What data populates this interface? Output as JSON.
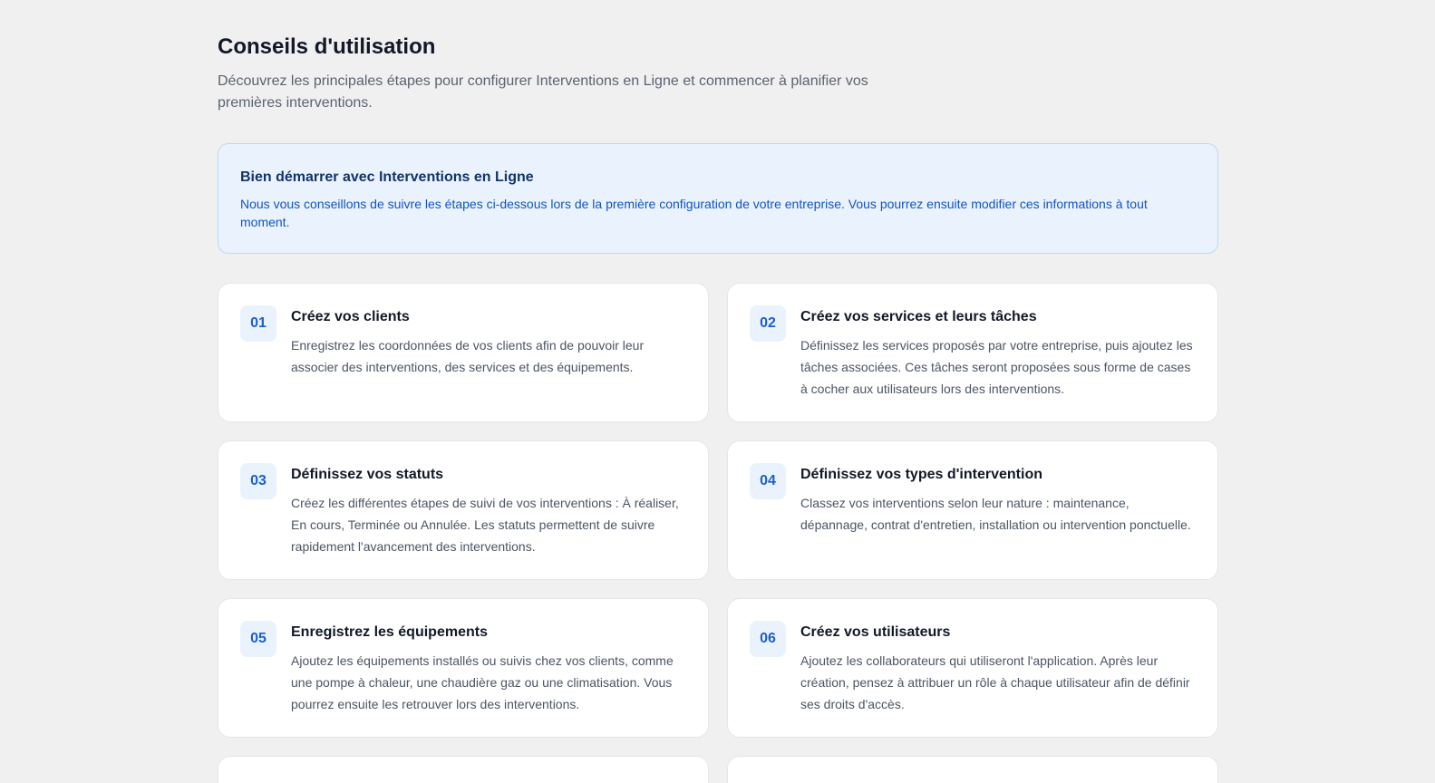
{
  "header": {
    "title": "Conseils d'utilisation",
    "subtitle": "Découvrez les principales étapes pour configurer Interventions en Ligne et commencer à planifier vos premières interventions."
  },
  "info": {
    "title": "Bien démarrer avec Interventions en Ligne",
    "text": "Nous vous conseillons de suivre les étapes ci-dessous lors de la première configuration de votre entreprise. Vous pourrez ensuite modifier ces informations à tout moment."
  },
  "steps": [
    {
      "number": "01",
      "title": "Créez vos clients",
      "text": "Enregistrez les coordonnées de vos clients afin de pouvoir leur associer des interventions, des services et des équipements."
    },
    {
      "number": "02",
      "title": "Créez vos services et leurs tâches",
      "text": "Définissez les services proposés par votre entreprise, puis ajoutez les tâches associées. Ces tâches seront proposées sous forme de cases à cocher aux utilisateurs lors des interventions."
    },
    {
      "number": "03",
      "title": "Définissez vos statuts",
      "text": "Créez les différentes étapes de suivi de vos interventions : À réaliser, En cours, Terminée ou Annulée. Les statuts permettent de suivre rapidement l'avancement des interventions."
    },
    {
      "number": "04",
      "title": "Définissez vos types d'intervention",
      "text": "Classez vos interventions selon leur nature : maintenance, dépannage, contrat d'entretien, installation ou intervention ponctuelle."
    },
    {
      "number": "05",
      "title": "Enregistrez les équipements",
      "text": "Ajoutez les équipements installés ou suivis chez vos clients, comme une pompe à chaleur, une chaudière gaz ou une climatisation. Vous pourrez ensuite les retrouver lors des interventions."
    },
    {
      "number": "06",
      "title": "Créez vos utilisateurs",
      "text": "Ajoutez les collaborateurs qui utiliseront l'application. Après leur création, pensez à attribuer un rôle à chaque utilisateur afin de définir ses droits d'accès."
    }
  ],
  "colors": {
    "background": "#f0f0f0",
    "accent": "#1b5fd0",
    "info_background": "#eaf3fd",
    "info_border": "#b9d8f7",
    "info_title": "#12346a",
    "info_text": "#1153c9"
  }
}
